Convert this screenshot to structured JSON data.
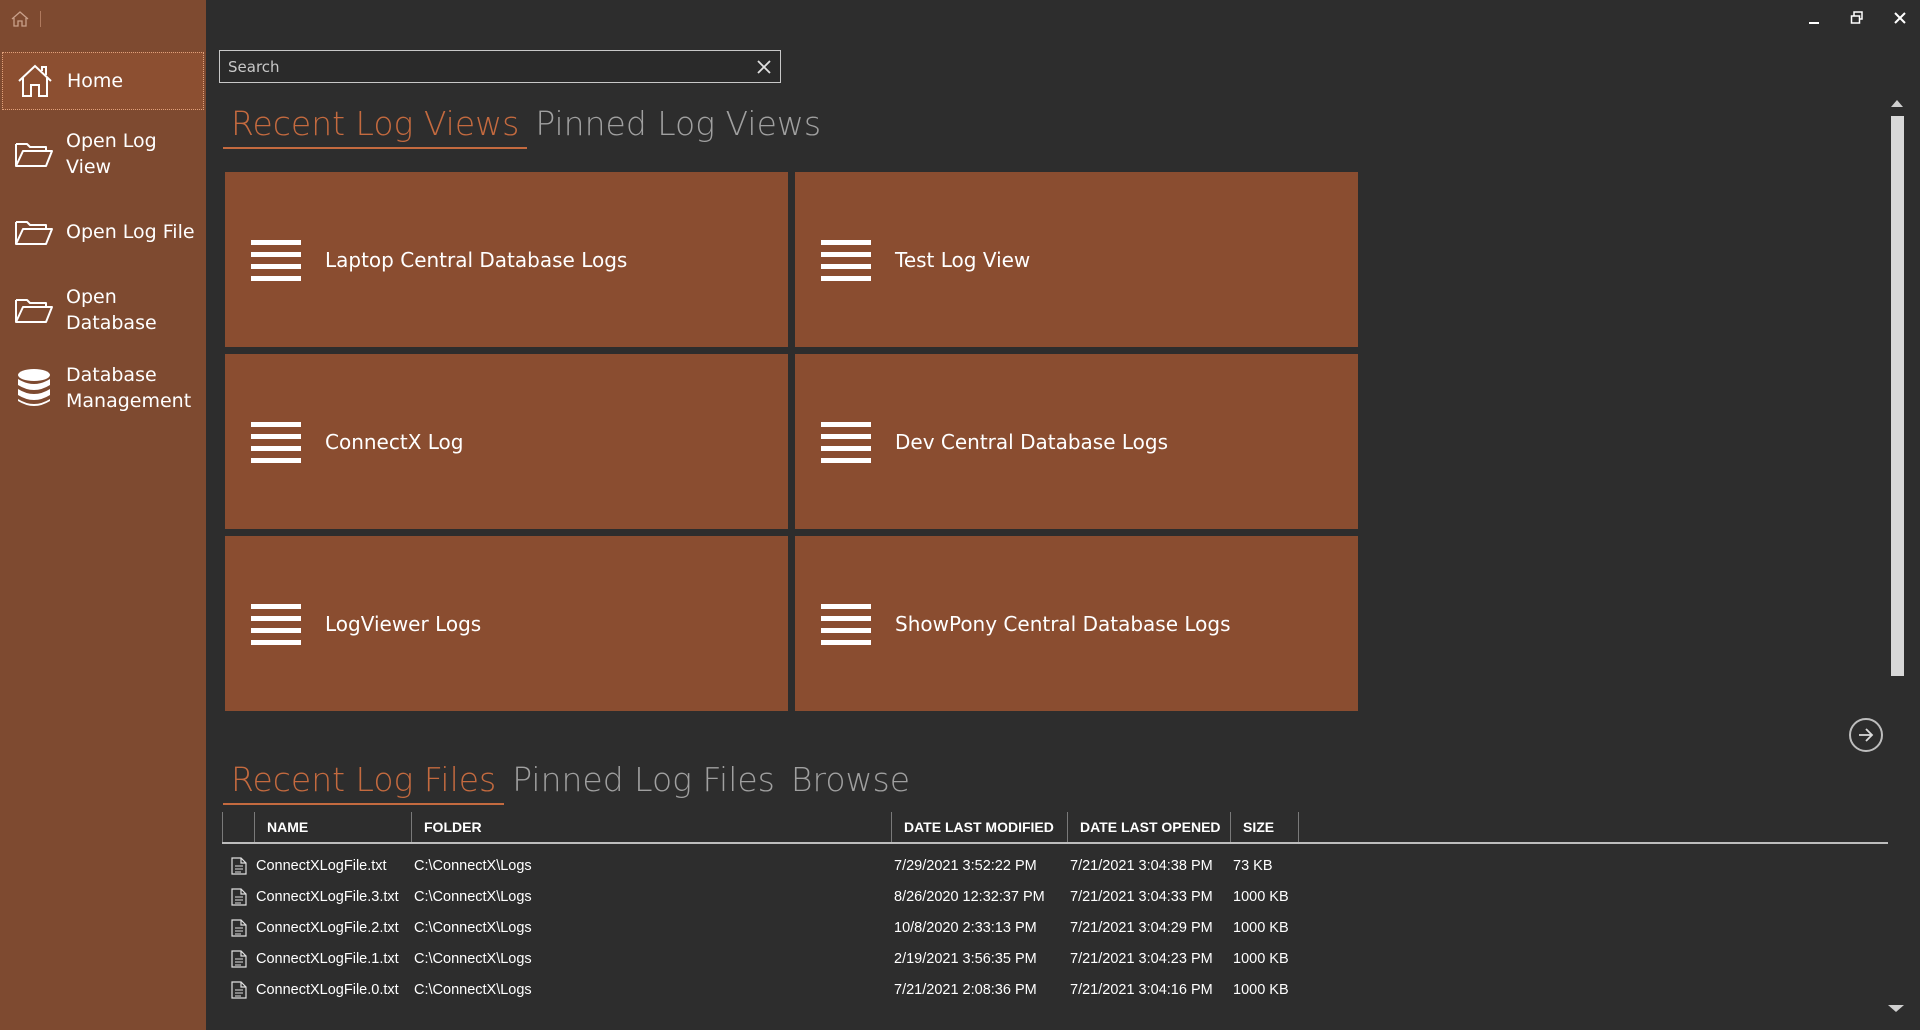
{
  "sidebar": {
    "items": [
      {
        "label": "Home",
        "icon": "home-icon"
      },
      {
        "label": "Open Log View",
        "icon": "folder-open-icon"
      },
      {
        "label": "Open Log File",
        "icon": "folder-open-icon"
      },
      {
        "label": "Open Database",
        "icon": "folder-open-icon"
      },
      {
        "label": "Database Management",
        "icon": "database-icon"
      }
    ]
  },
  "search": {
    "placeholder": "Search",
    "value": ""
  },
  "log_view_tabs": [
    "Recent Log Views",
    "Pinned Log Views"
  ],
  "tiles": [
    {
      "label": "Laptop Central Database Logs",
      "icon": "list-icon"
    },
    {
      "label": "Test Log View",
      "icon": "list-icon"
    },
    {
      "label": "ConnectX Log",
      "icon": "list-icon"
    },
    {
      "label": "Dev Central Database Logs",
      "icon": "list-icon"
    },
    {
      "label": "LogViewer Logs",
      "icon": "list-icon"
    },
    {
      "label": "ShowPony Central Database Logs",
      "icon": "list-icon"
    }
  ],
  "log_file_tabs": [
    "Recent Log Files",
    "Pinned Log Files",
    "Browse"
  ],
  "table": {
    "columns": [
      "NAME",
      "FOLDER",
      "DATE LAST MODIFIED",
      "DATE LAST OPENED",
      "SIZE"
    ],
    "rows": [
      {
        "name": "ConnectXLogFile.txt",
        "folder": "C:\\ConnectX\\Logs",
        "modified": "7/29/2021 3:52:22 PM",
        "opened": "7/21/2021 3:04:38 PM",
        "size": "73 KB"
      },
      {
        "name": "ConnectXLogFile.3.txt",
        "folder": "C:\\ConnectX\\Logs",
        "modified": "8/26/2020 12:32:37 PM",
        "opened": "7/21/2021 3:04:33 PM",
        "size": "1000 KB"
      },
      {
        "name": "ConnectXLogFile.2.txt",
        "folder": "C:\\ConnectX\\Logs",
        "modified": "10/8/2020 2:33:13 PM",
        "opened": "7/21/2021 3:04:29 PM",
        "size": "1000 KB"
      },
      {
        "name": "ConnectXLogFile.1.txt",
        "folder": "C:\\ConnectX\\Logs",
        "modified": "2/19/2021 3:56:35 PM",
        "opened": "7/21/2021 3:04:23 PM",
        "size": "1000 KB"
      },
      {
        "name": "ConnectXLogFile.0.txt",
        "folder": "C:\\ConnectX\\Logs",
        "modified": "7/21/2021 2:08:36 PM",
        "opened": "7/21/2021 3:04:16 PM",
        "size": "1000 KB"
      }
    ]
  },
  "colors": {
    "accent": "#c46a3f",
    "sidebar": "#7e4a30",
    "tile": "#8a4d30",
    "background": "#2d2d2d"
  }
}
